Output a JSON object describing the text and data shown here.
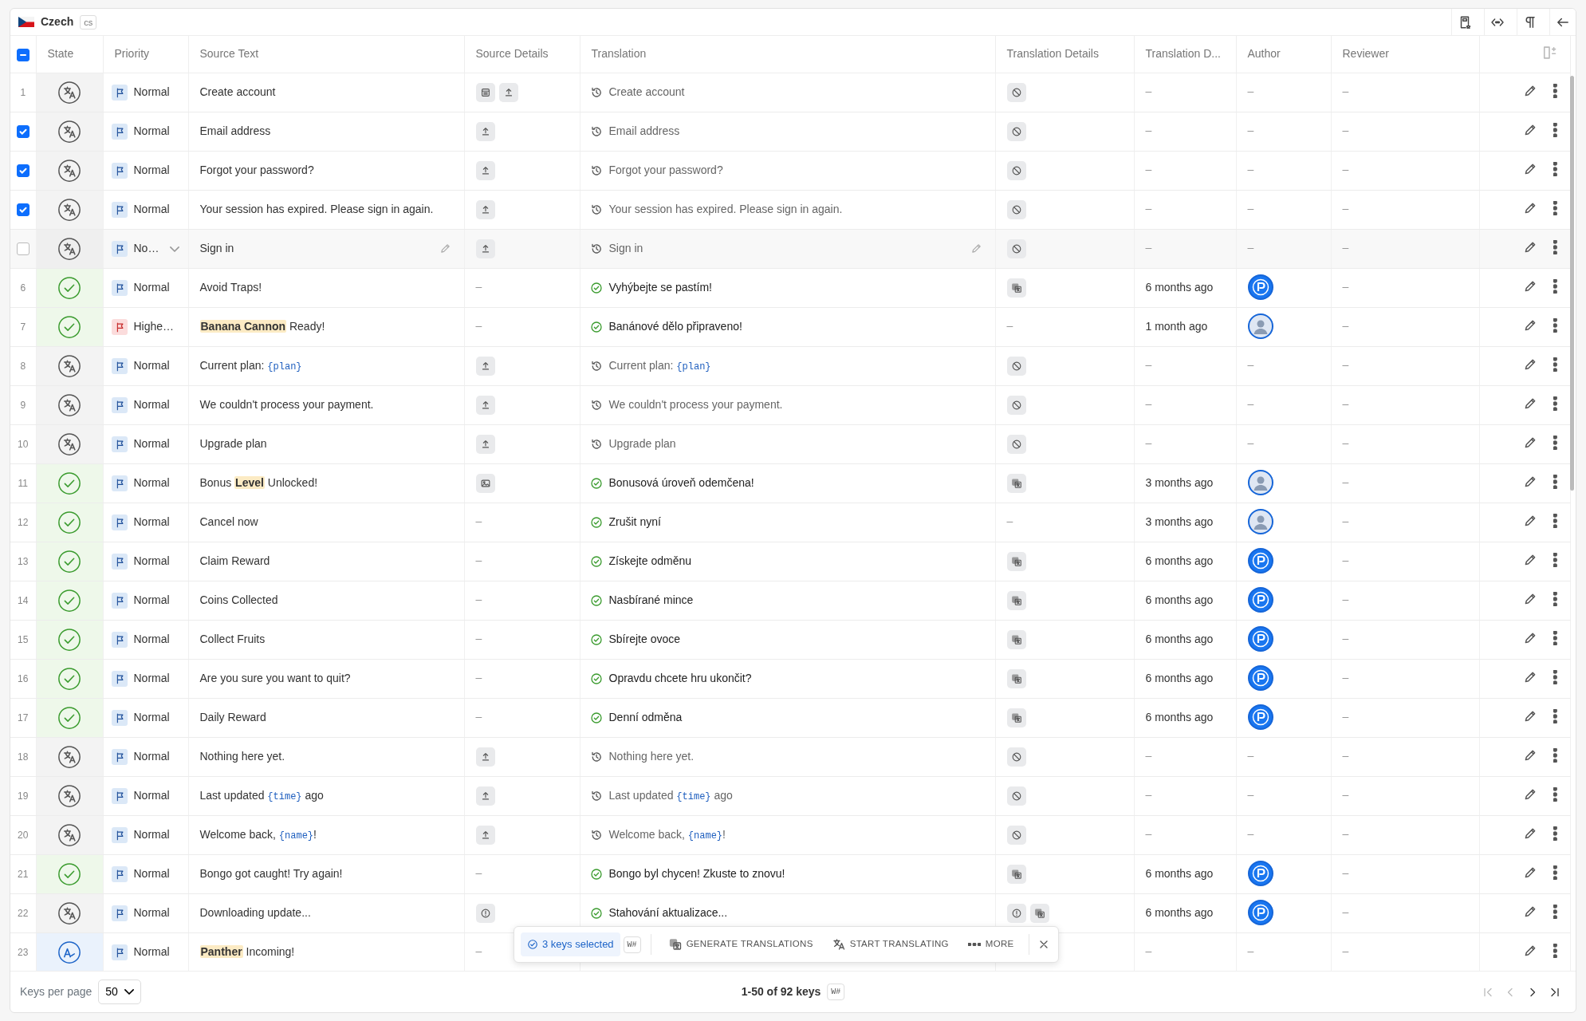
{
  "language": {
    "name": "Czech",
    "code": "cs"
  },
  "select_all": {
    "indeterminate": true
  },
  "columns": [
    "State",
    "Priority",
    "Source Text",
    "Source Details",
    "Translation",
    "Translation Details",
    "Translation D...",
    "Author",
    "Reviewer"
  ],
  "rows": [
    {
      "number": "1",
      "selected": false,
      "hovered": false,
      "state": {
        "kind": "untranslated"
      },
      "priority": {
        "label": "Normal",
        "kind": "normal"
      },
      "source": [
        {
          "kind": "plain",
          "text": "Create account"
        }
      ],
      "source_details": {
        "icons": [
          {
            "kind": "calendar"
          },
          {
            "kind": "upload"
          }
        ]
      },
      "translation": {
        "kind": "outdated",
        "segments": [
          {
            "kind": "plain",
            "text": "Create account"
          }
        ]
      },
      "translation_details": {
        "icons": [
          {
            "kind": "disabled"
          }
        ]
      },
      "translated_at": "–",
      "author": {
        "kind": "none",
        "text": "–"
      },
      "reviewer": "–"
    },
    {
      "selected": true,
      "hovered": false,
      "state": {
        "kind": "untranslated"
      },
      "priority": {
        "label": "Normal",
        "kind": "normal"
      },
      "source": [
        {
          "kind": "plain",
          "text": "Email address"
        }
      ],
      "source_details": {
        "icons": [
          {
            "kind": "upload"
          }
        ]
      },
      "translation": {
        "kind": "outdated",
        "segments": [
          {
            "kind": "plain",
            "text": "Email address"
          }
        ]
      },
      "translation_details": {
        "icons": [
          {
            "kind": "disabled"
          }
        ]
      },
      "translated_at": "–",
      "author": {
        "kind": "none",
        "text": "–"
      },
      "reviewer": "–"
    },
    {
      "selected": true,
      "hovered": false,
      "state": {
        "kind": "untranslated"
      },
      "priority": {
        "label": "Normal",
        "kind": "normal"
      },
      "source": [
        {
          "kind": "plain",
          "text": "Forgot your password?"
        }
      ],
      "source_details": {
        "icons": [
          {
            "kind": "upload"
          }
        ]
      },
      "translation": {
        "kind": "outdated",
        "segments": [
          {
            "kind": "plain",
            "text": "Forgot your password?"
          }
        ]
      },
      "translation_details": {
        "icons": [
          {
            "kind": "disabled"
          }
        ]
      },
      "translated_at": "–",
      "author": {
        "kind": "none",
        "text": "–"
      },
      "reviewer": "–"
    },
    {
      "selected": true,
      "hovered": false,
      "state": {
        "kind": "untranslated"
      },
      "priority": {
        "label": "Normal",
        "kind": "normal"
      },
      "source": [
        {
          "kind": "plain",
          "text": "Your session has expired. Please sign in again."
        }
      ],
      "source_details": {
        "icons": [
          {
            "kind": "upload"
          }
        ]
      },
      "translation": {
        "kind": "outdated",
        "segments": [
          {
            "kind": "plain",
            "text": "Your session has expired. Please sign in again."
          }
        ]
      },
      "translation_details": {
        "icons": [
          {
            "kind": "disabled"
          }
        ]
      },
      "translated_at": "–",
      "author": {
        "kind": "none",
        "text": "–"
      },
      "reviewer": "–"
    },
    {
      "selected": false,
      "hovered": true,
      "state": {
        "kind": "untranslated"
      },
      "priority": {
        "label": "No…",
        "kind": "normal"
      },
      "source": [
        {
          "kind": "plain",
          "text": "Sign in"
        }
      ],
      "source_details": {
        "icons": [
          {
            "kind": "upload"
          }
        ]
      },
      "translation": {
        "kind": "outdated",
        "segments": [
          {
            "kind": "plain",
            "text": "Sign in"
          }
        ]
      },
      "translation_details": {
        "icons": [
          {
            "kind": "disabled"
          }
        ]
      },
      "translated_at": "–",
      "author": {
        "kind": "none",
        "text": "–"
      },
      "reviewer": "–"
    },
    {
      "number": "6",
      "selected": false,
      "hovered": false,
      "state": {
        "kind": "translated"
      },
      "priority": {
        "label": "Normal",
        "kind": "normal"
      },
      "source": [
        {
          "kind": "plain",
          "text": "Avoid Traps!"
        }
      ],
      "source_details": {
        "text": "–"
      },
      "translation": {
        "kind": "done",
        "segments": [
          {
            "kind": "plain",
            "text": "Vyhýbejte se pastím!"
          }
        ]
      },
      "translation_details": {
        "icons": [
          {
            "kind": "machine"
          }
        ]
      },
      "translated_at": "6 months ago",
      "author": {
        "kind": "logo"
      },
      "reviewer": "–"
    },
    {
      "number": "7",
      "selected": false,
      "hovered": false,
      "state": {
        "kind": "translated"
      },
      "priority": {
        "label": "Highe…",
        "kind": "high"
      },
      "source": [
        {
          "kind": "term",
          "text": "Banana Cannon"
        },
        {
          "kind": "plain",
          "text": " Ready!"
        }
      ],
      "source_details": {
        "text": "–"
      },
      "translation": {
        "kind": "done",
        "segments": [
          {
            "kind": "plain",
            "text": "Banánové dělo připraveno!"
          }
        ]
      },
      "translation_details": {
        "text": "–"
      },
      "translated_at": "1 month ago",
      "author": {
        "kind": "person"
      },
      "reviewer": "–"
    },
    {
      "number": "8",
      "selected": false,
      "hovered": false,
      "state": {
        "kind": "untranslated"
      },
      "priority": {
        "label": "Normal",
        "kind": "normal"
      },
      "source": [
        {
          "kind": "plain",
          "text": "Current plan: "
        },
        {
          "kind": "placeholder",
          "text": "{plan}"
        }
      ],
      "source_details": {
        "icons": [
          {
            "kind": "upload"
          }
        ]
      },
      "translation": {
        "kind": "outdated",
        "segments": [
          {
            "kind": "plain",
            "text": "Current plan: "
          },
          {
            "kind": "placeholder",
            "text": "{plan}"
          }
        ]
      },
      "translation_details": {
        "icons": [
          {
            "kind": "disabled"
          }
        ]
      },
      "translated_at": "–",
      "author": {
        "kind": "none",
        "text": "–"
      },
      "reviewer": "–"
    },
    {
      "number": "9",
      "selected": false,
      "hovered": false,
      "state": {
        "kind": "untranslated"
      },
      "priority": {
        "label": "Normal",
        "kind": "normal"
      },
      "source": [
        {
          "kind": "plain",
          "text": "We couldn't process your payment."
        }
      ],
      "source_details": {
        "icons": [
          {
            "kind": "upload"
          }
        ]
      },
      "translation": {
        "kind": "outdated",
        "segments": [
          {
            "kind": "plain",
            "text": "We couldn't process your payment."
          }
        ]
      },
      "translation_details": {
        "icons": [
          {
            "kind": "disabled"
          }
        ]
      },
      "translated_at": "–",
      "author": {
        "kind": "none",
        "text": "–"
      },
      "reviewer": "–"
    },
    {
      "number": "10",
      "selected": false,
      "hovered": false,
      "state": {
        "kind": "untranslated"
      },
      "priority": {
        "label": "Normal",
        "kind": "normal"
      },
      "source": [
        {
          "kind": "plain",
          "text": "Upgrade plan"
        }
      ],
      "source_details": {
        "icons": [
          {
            "kind": "upload"
          }
        ]
      },
      "translation": {
        "kind": "outdated",
        "segments": [
          {
            "kind": "plain",
            "text": "Upgrade plan"
          }
        ]
      },
      "translation_details": {
        "icons": [
          {
            "kind": "disabled"
          }
        ]
      },
      "translated_at": "–",
      "author": {
        "kind": "none",
        "text": "–"
      },
      "reviewer": "–"
    },
    {
      "number": "11",
      "selected": false,
      "hovered": false,
      "state": {
        "kind": "translated"
      },
      "priority": {
        "label": "Normal",
        "kind": "normal"
      },
      "source": [
        {
          "kind": "plain",
          "text": "Bonus "
        },
        {
          "kind": "term",
          "text": "Level"
        },
        {
          "kind": "plain",
          "text": " Unlocked!"
        }
      ],
      "source_details": {
        "icons": [
          {
            "kind": "image"
          }
        ]
      },
      "translation": {
        "kind": "done",
        "segments": [
          {
            "kind": "plain",
            "text": "Bonusová úroveň odemčena!"
          }
        ]
      },
      "translation_details": {
        "icons": [
          {
            "kind": "machine"
          }
        ]
      },
      "translated_at": "3 months ago",
      "author": {
        "kind": "person"
      },
      "reviewer": "–"
    },
    {
      "number": "12",
      "selected": false,
      "hovered": false,
      "state": {
        "kind": "translated"
      },
      "priority": {
        "label": "Normal",
        "kind": "normal"
      },
      "source": [
        {
          "kind": "plain",
          "text": "Cancel now"
        }
      ],
      "source_details": {
        "text": "–"
      },
      "translation": {
        "kind": "done",
        "segments": [
          {
            "kind": "plain",
            "text": "Zrušit nyní"
          }
        ]
      },
      "translation_details": {
        "text": "–"
      },
      "translated_at": "3 months ago",
      "author": {
        "kind": "person"
      },
      "reviewer": "–"
    },
    {
      "number": "13",
      "selected": false,
      "hovered": false,
      "state": {
        "kind": "translated"
      },
      "priority": {
        "label": "Normal",
        "kind": "normal"
      },
      "source": [
        {
          "kind": "plain",
          "text": "Claim Reward"
        }
      ],
      "source_details": {
        "text": "–"
      },
      "translation": {
        "kind": "done",
        "segments": [
          {
            "kind": "plain",
            "text": "Získejte odměnu"
          }
        ]
      },
      "translation_details": {
        "icons": [
          {
            "kind": "machine"
          }
        ]
      },
      "translated_at": "6 months ago",
      "author": {
        "kind": "logo"
      },
      "reviewer": "–"
    },
    {
      "number": "14",
      "selected": false,
      "hovered": false,
      "state": {
        "kind": "translated"
      },
      "priority": {
        "label": "Normal",
        "kind": "normal"
      },
      "source": [
        {
          "kind": "plain",
          "text": "Coins Collected"
        }
      ],
      "source_details": {
        "text": "–"
      },
      "translation": {
        "kind": "done",
        "segments": [
          {
            "kind": "plain",
            "text": "Nasbírané mince"
          }
        ]
      },
      "translation_details": {
        "icons": [
          {
            "kind": "machine"
          }
        ]
      },
      "translated_at": "6 months ago",
      "author": {
        "kind": "logo"
      },
      "reviewer": "–"
    },
    {
      "number": "15",
      "selected": false,
      "hovered": false,
      "state": {
        "kind": "translated"
      },
      "priority": {
        "label": "Normal",
        "kind": "normal"
      },
      "source": [
        {
          "kind": "plain",
          "text": "Collect Fruits"
        }
      ],
      "source_details": {
        "text": "–"
      },
      "translation": {
        "kind": "done",
        "segments": [
          {
            "kind": "plain",
            "text": "Sbírejte ovoce"
          }
        ]
      },
      "translation_details": {
        "icons": [
          {
            "kind": "machine"
          }
        ]
      },
      "translated_at": "6 months ago",
      "author": {
        "kind": "logo"
      },
      "reviewer": "–"
    },
    {
      "number": "16",
      "selected": false,
      "hovered": false,
      "state": {
        "kind": "translated"
      },
      "priority": {
        "label": "Normal",
        "kind": "normal"
      },
      "source": [
        {
          "kind": "plain",
          "text": "Are you sure you want to quit?"
        }
      ],
      "source_details": {
        "text": "–"
      },
      "translation": {
        "kind": "done",
        "segments": [
          {
            "kind": "plain",
            "text": "Opravdu chcete hru ukončit?"
          }
        ]
      },
      "translation_details": {
        "icons": [
          {
            "kind": "machine"
          }
        ]
      },
      "translated_at": "6 months ago",
      "author": {
        "kind": "logo"
      },
      "reviewer": "–"
    },
    {
      "number": "17",
      "selected": false,
      "hovered": false,
      "state": {
        "kind": "translated"
      },
      "priority": {
        "label": "Normal",
        "kind": "normal"
      },
      "source": [
        {
          "kind": "plain",
          "text": "Daily Reward"
        }
      ],
      "source_details": {
        "text": "–"
      },
      "translation": {
        "kind": "done",
        "segments": [
          {
            "kind": "plain",
            "text": "Denní odměna"
          }
        ]
      },
      "translation_details": {
        "icons": [
          {
            "kind": "machine"
          }
        ]
      },
      "translated_at": "6 months ago",
      "author": {
        "kind": "logo"
      },
      "reviewer": "–"
    },
    {
      "number": "18",
      "selected": false,
      "hovered": false,
      "state": {
        "kind": "untranslated"
      },
      "priority": {
        "label": "Normal",
        "kind": "normal"
      },
      "source": [
        {
          "kind": "plain",
          "text": "Nothing here yet."
        }
      ],
      "source_details": {
        "icons": [
          {
            "kind": "upload"
          }
        ]
      },
      "translation": {
        "kind": "outdated",
        "segments": [
          {
            "kind": "plain",
            "text": "Nothing here yet."
          }
        ]
      },
      "translation_details": {
        "icons": [
          {
            "kind": "disabled"
          }
        ]
      },
      "translated_at": "–",
      "author": {
        "kind": "none",
        "text": "–"
      },
      "reviewer": "–"
    },
    {
      "number": "19",
      "selected": false,
      "hovered": false,
      "state": {
        "kind": "untranslated"
      },
      "priority": {
        "label": "Normal",
        "kind": "normal"
      },
      "source": [
        {
          "kind": "plain",
          "text": "Last updated "
        },
        {
          "kind": "placeholder",
          "text": "{time}"
        },
        {
          "kind": "plain",
          "text": " ago"
        }
      ],
      "source_details": {
        "icons": [
          {
            "kind": "upload"
          }
        ]
      },
      "translation": {
        "kind": "outdated",
        "segments": [
          {
            "kind": "plain",
            "text": "Last updated "
          },
          {
            "kind": "placeholder",
            "text": "{time}"
          },
          {
            "kind": "plain",
            "text": " ago"
          }
        ]
      },
      "translation_details": {
        "icons": [
          {
            "kind": "disabled"
          }
        ]
      },
      "translated_at": "–",
      "author": {
        "kind": "none",
        "text": "–"
      },
      "reviewer": "–"
    },
    {
      "number": "20",
      "selected": false,
      "hovered": false,
      "state": {
        "kind": "untranslated"
      },
      "priority": {
        "label": "Normal",
        "kind": "normal"
      },
      "source": [
        {
          "kind": "plain",
          "text": "Welcome back, "
        },
        {
          "kind": "placeholder",
          "text": "{name}"
        },
        {
          "kind": "plain",
          "text": "!"
        }
      ],
      "source_details": {
        "icons": [
          {
            "kind": "upload"
          }
        ]
      },
      "translation": {
        "kind": "outdated",
        "segments": [
          {
            "kind": "plain",
            "text": "Welcome back, "
          },
          {
            "kind": "placeholder",
            "text": "{name}"
          },
          {
            "kind": "plain",
            "text": "!"
          }
        ]
      },
      "translation_details": {
        "icons": [
          {
            "kind": "disabled"
          }
        ]
      },
      "translated_at": "–",
      "author": {
        "kind": "none",
        "text": "–"
      },
      "reviewer": "–"
    },
    {
      "number": "21",
      "selected": false,
      "hovered": false,
      "state": {
        "kind": "translated"
      },
      "priority": {
        "label": "Normal",
        "kind": "normal"
      },
      "source": [
        {
          "kind": "plain",
          "text": "Bongo got caught! Try again!"
        }
      ],
      "source_details": {
        "text": "–"
      },
      "translation": {
        "kind": "done",
        "segments": [
          {
            "kind": "plain",
            "text": "Bongo byl chycen! Zkuste to znovu!"
          }
        ]
      },
      "translation_details": {
        "icons": [
          {
            "kind": "machine"
          }
        ]
      },
      "translated_at": "6 months ago",
      "author": {
        "kind": "logo"
      },
      "reviewer": "–"
    },
    {
      "number": "22",
      "selected": false,
      "hovered": false,
      "state": {
        "kind": "untranslated"
      },
      "priority": {
        "label": "Normal",
        "kind": "normal"
      },
      "source": [
        {
          "kind": "plain",
          "text": "Downloading update..."
        }
      ],
      "source_details": {
        "icons": [
          {
            "kind": "info"
          }
        ]
      },
      "translation": {
        "kind": "done",
        "segments": [
          {
            "kind": "plain",
            "text": "Stahování aktualizace..."
          }
        ]
      },
      "translation_details": {
        "icons": [
          {
            "kind": "info"
          },
          {
            "kind": "machine"
          }
        ]
      },
      "translated_at": "6 months ago",
      "author": {
        "kind": "logo"
      },
      "reviewer": "–"
    },
    {
      "number": "23",
      "selected": false,
      "hovered": false,
      "state": {
        "kind": "reviewing"
      },
      "priority": {
        "label": "Normal",
        "kind": "normal"
      },
      "source": [
        {
          "kind": "term",
          "text": "Panther"
        },
        {
          "kind": "plain",
          "text": " Incoming!"
        }
      ],
      "source_details": {
        "text": "–"
      },
      "translated_at": "–",
      "author": {
        "kind": "none",
        "text": "–"
      },
      "reviewer": "–"
    }
  ],
  "selection_bar": {
    "count": "3 keys selected",
    "shortcut": "W#",
    "actions": [
      "GENERATE TRANSLATIONS",
      "START TRANSLATING",
      "MORE"
    ]
  },
  "footer": {
    "per_page_label": "Keys per page",
    "per_page": "50",
    "range": "1-50 of 92 keys",
    "shortcut": "W#",
    "can_go_back": false,
    "can_go_forward": true
  }
}
